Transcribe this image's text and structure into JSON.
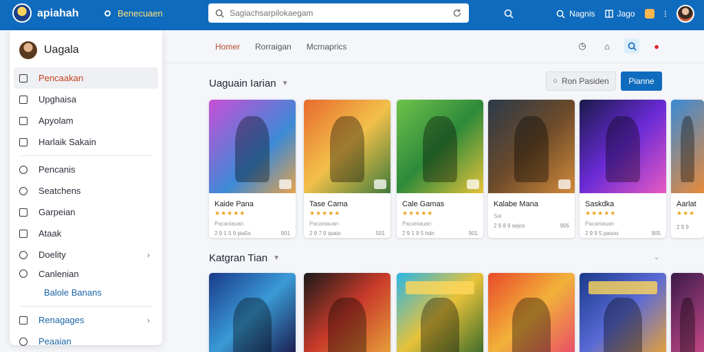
{
  "topbar": {
    "app_title": "apiahah",
    "nav_link": "Benecuaen",
    "search_placeholder": "Sagiachsarpilokaegam",
    "items": [
      "Nagnis",
      "Jago"
    ]
  },
  "sidebar": {
    "user_name": "Uagala",
    "items": [
      {
        "label": "Pencaakan",
        "icon": "home-icon"
      },
      {
        "label": "Upghaisa",
        "icon": "folder-icon"
      },
      {
        "label": "Apyolam",
        "icon": "document-icon"
      },
      {
        "label": "Harlaik Sakain",
        "icon": "image-icon"
      },
      {
        "label": "Pencanis",
        "icon": "shield-icon"
      },
      {
        "label": "Seatchens",
        "icon": "location-icon"
      },
      {
        "label": "Garpeian",
        "icon": "tag-icon"
      },
      {
        "label": "Ataak",
        "icon": "list-icon"
      },
      {
        "label": "Doelity",
        "icon": "star-icon"
      },
      {
        "label": "Canlenian",
        "icon": "link-icon"
      },
      {
        "label": "Balole Banans",
        "icon": ""
      },
      {
        "label": "Renagages",
        "icon": "grid-icon"
      },
      {
        "label": "Peaaian",
        "icon": "help-icon"
      }
    ]
  },
  "main": {
    "tabs": [
      "Homer",
      "Rorraigan",
      "Mcrnaprics"
    ],
    "section1_title": "Uaguain Iarian",
    "filter_button": "Ron Pasiden",
    "primary_button": "Pianne",
    "section2_title": "Katgran Tian",
    "cards": [
      {
        "name": "Kaide Pana",
        "stars": "★★★★★",
        "meta": "Pacaniauan",
        "foot_left": "2 9 1 5 9 pia5o",
        "foot_right": "901"
      },
      {
        "name": "Tase Cama",
        "stars": "★★★★★",
        "meta": "Pacaniauan",
        "foot_left": "2 9 7 9 spaio",
        "foot_right": "501"
      },
      {
        "name": "Cale Gamas",
        "stars": "★★★★★",
        "meta": "Pacaniauan",
        "foot_left": "2 9 1 9 5 hdn",
        "foot_right": "901"
      },
      {
        "name": "Kalabe Mana",
        "stars": "",
        "meta": "Sel",
        "foot_left": "2 9 8 9 sejos",
        "foot_right": "905"
      },
      {
        "name": "Saskdka",
        "stars": "★★★★★",
        "meta": "Pacaniauan",
        "foot_left": "2 9 9 5 pasoo",
        "foot_right": "905"
      },
      {
        "name": "Aarlat",
        "stars": "★★★",
        "meta": "",
        "foot_left": "2 9 9",
        "foot_right": ""
      }
    ]
  }
}
